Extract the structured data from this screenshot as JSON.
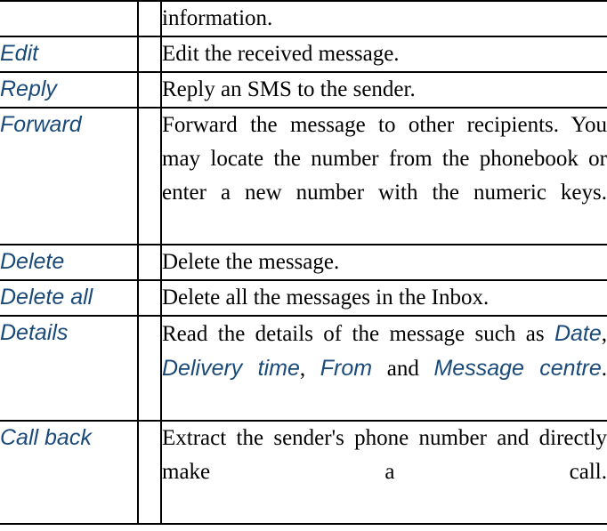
{
  "document": {
    "type": "reference-table",
    "columns": [
      "option",
      "spacer",
      "description"
    ],
    "rows": [
      {
        "label": "",
        "description_tail": "information.",
        "cropped": true
      },
      {
        "label": "Edit",
        "description": "Edit the received message."
      },
      {
        "label": "Reply",
        "description": "Reply an SMS to the sender."
      },
      {
        "label": "Forward",
        "description": "Forward the message to other recipients. You may locate the number from the phonebook or enter a new number with the numeric keys."
      },
      {
        "label": "Delete",
        "description": "Delete the message."
      },
      {
        "label": "Delete all",
        "description": "Delete all the messages in the Inbox."
      },
      {
        "label": "Details",
        "description_parts": [
          {
            "text": "Read the details of the message such as ",
            "style": "plain"
          },
          {
            "text": "Date",
            "style": "term"
          },
          {
            "text": ", ",
            "style": "plain"
          },
          {
            "text": "Delivery time",
            "style": "term"
          },
          {
            "text": ", ",
            "style": "plain"
          },
          {
            "text": "From",
            "style": "term"
          },
          {
            "text": " and ",
            "style": "plain"
          },
          {
            "text": "Message centre",
            "style": "term"
          },
          {
            "text": ".",
            "style": "plain"
          }
        ]
      },
      {
        "label": "Call back",
        "description": "Extract the sender's phone number and directly make a call."
      }
    ]
  },
  "colors": {
    "label_blue": "#1a4a7a",
    "body_black": "#000000",
    "rule": "#000000",
    "page": "#ffffff"
  }
}
